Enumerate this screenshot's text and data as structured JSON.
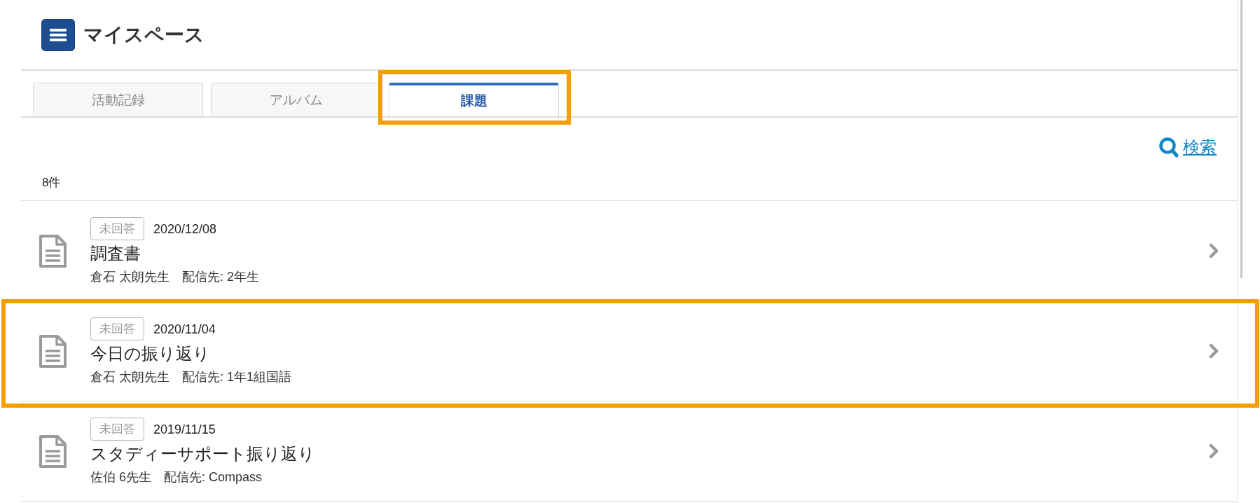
{
  "header": {
    "title": "マイスペース"
  },
  "tabs": [
    {
      "label": "活動記録",
      "selected": false,
      "highlighted": false
    },
    {
      "label": "アルバム",
      "selected": false,
      "highlighted": false
    },
    {
      "label": "課題",
      "selected": true,
      "highlighted": true
    }
  ],
  "search_link": {
    "label": "検索"
  },
  "count": "8件",
  "assignments": [
    {
      "status": "未回答",
      "date": "2020/12/08",
      "title": "調査書",
      "teacher": "倉石 太朗先生",
      "destination": "配信先: 2年生",
      "highlighted": false
    },
    {
      "status": "未回答",
      "date": "2020/11/04",
      "title": "今日の振り返り",
      "teacher": "倉石 太朗先生",
      "destination": "配信先: 1年1組国語",
      "highlighted": true
    },
    {
      "status": "未回答",
      "date": "2019/11/15",
      "title": "スタディーサポート振り返り",
      "teacher": "佐伯 6先生",
      "destination": "配信先: Compass",
      "highlighted": false
    }
  ]
}
